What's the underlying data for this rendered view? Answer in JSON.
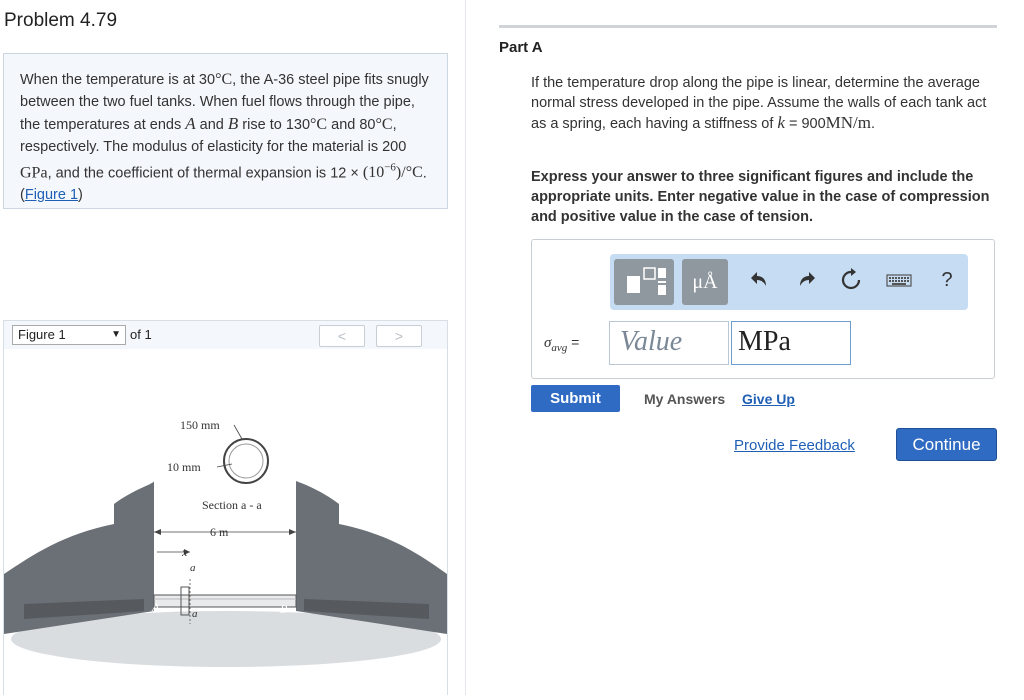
{
  "problem": {
    "title": "Problem 4.79",
    "p1": "When the temperature is at 30",
    "t1": "°C",
    "p2": ", the A-36 steel pipe fits snugly between the two fuel tanks. When fuel flows through the pipe, the temperatures at ends ",
    "A": "A",
    "and": " and ",
    "B": "B",
    "p3": " rise to 130",
    "t2": "°C",
    "p4": " and 80",
    "t3": "°C",
    "p5": ", respectively. The modulus of elasticity for the material is 200 ",
    "gpa": "GPa",
    "p6": ", and the coefficient of thermal expansion is 12 × ",
    "alpha": "(10",
    "alpha_exp": "−6",
    "alpha_unit": ")/°C",
    "p7": ". (",
    "fig_link": "Figure 1",
    "p8": ")"
  },
  "figure_nav": {
    "select": "Figure 1",
    "of": "of 1",
    "prev": "<",
    "next": ">"
  },
  "figure": {
    "dim_150": "150 mm",
    "dim_10": "10 mm",
    "section": "Section a - a",
    "dim_6m": "6 m",
    "x": "x",
    "a1": "a",
    "a2": "a",
    "A": "A",
    "B": "B"
  },
  "part": {
    "title": "Part A",
    "q1": "If the temperature drop along the pipe is linear, determine the average normal stress developed in the pipe. Assume the walls of each tank act as a spring, each having a stiffness of ",
    "k": "k",
    "q2": " = 900",
    "k_unit": "MN/m",
    "q3": ".",
    "instructions": "Express your answer to three significant figures and include the appropriate units. Enter negative value in the case of compression and positive value in the case of tension."
  },
  "answer": {
    "mu_label": "μÅ",
    "help": "?",
    "sigma": "σ",
    "sub": "avg",
    "eq": " =",
    "value_placeholder": "Value",
    "unit": "MPa"
  },
  "actions": {
    "submit": "Submit",
    "my_answers": "My Answers",
    "give_up": "Give Up",
    "feedback": "Provide Feedback",
    "continue": "Continue"
  },
  "colors": {
    "accent": "#2f6bc3",
    "link": "#1f5fb6",
    "toolbar": "#c5dcf3"
  }
}
